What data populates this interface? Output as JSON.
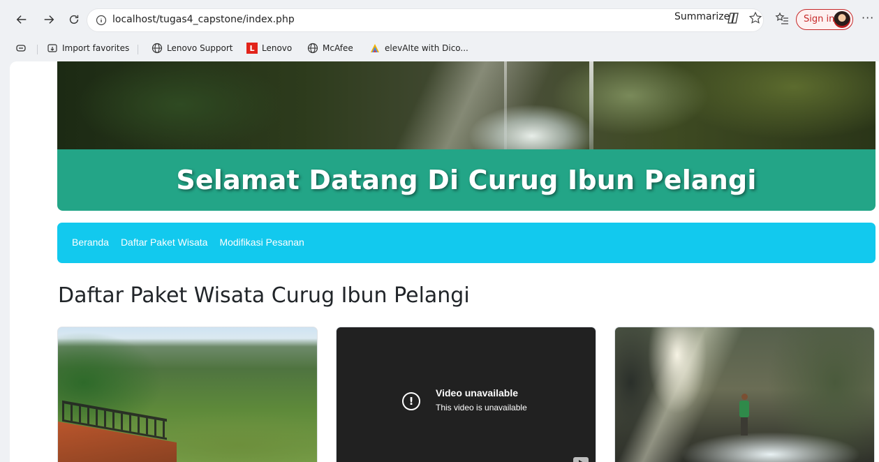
{
  "browser": {
    "url": "localhost/tugas4_capstone/index.php",
    "summarize_label": "Summarize",
    "signin_label": "Sign in",
    "more_label": "···"
  },
  "bookmarks": [
    {
      "label": "Import favorites",
      "icon": "import-icon"
    },
    {
      "label": "Lenovo Support",
      "icon": "globe-icon"
    },
    {
      "label": "Lenovo",
      "icon": "lenovo-logo-icon"
    },
    {
      "label": "McAfee",
      "icon": "globe-icon"
    },
    {
      "label": "elevAIte with Dico...",
      "icon": "elevaite-icon"
    }
  ],
  "page": {
    "hero_title": "Selamat Datang Di Curug Ibun Pelangi",
    "nav": [
      "Beranda",
      "Daftar Paket Wisata",
      "Modifikasi Pesanan"
    ],
    "section_title": "Daftar Paket Wisata Curug Ibun Pelangi",
    "video": {
      "title": "Video unavailable",
      "subtitle": "This video is unavailable"
    }
  },
  "colors": {
    "hero_band": "#23a587",
    "navbar": "#12c9ee",
    "video_bg": "#212121",
    "signin_accent": "#c62828"
  }
}
